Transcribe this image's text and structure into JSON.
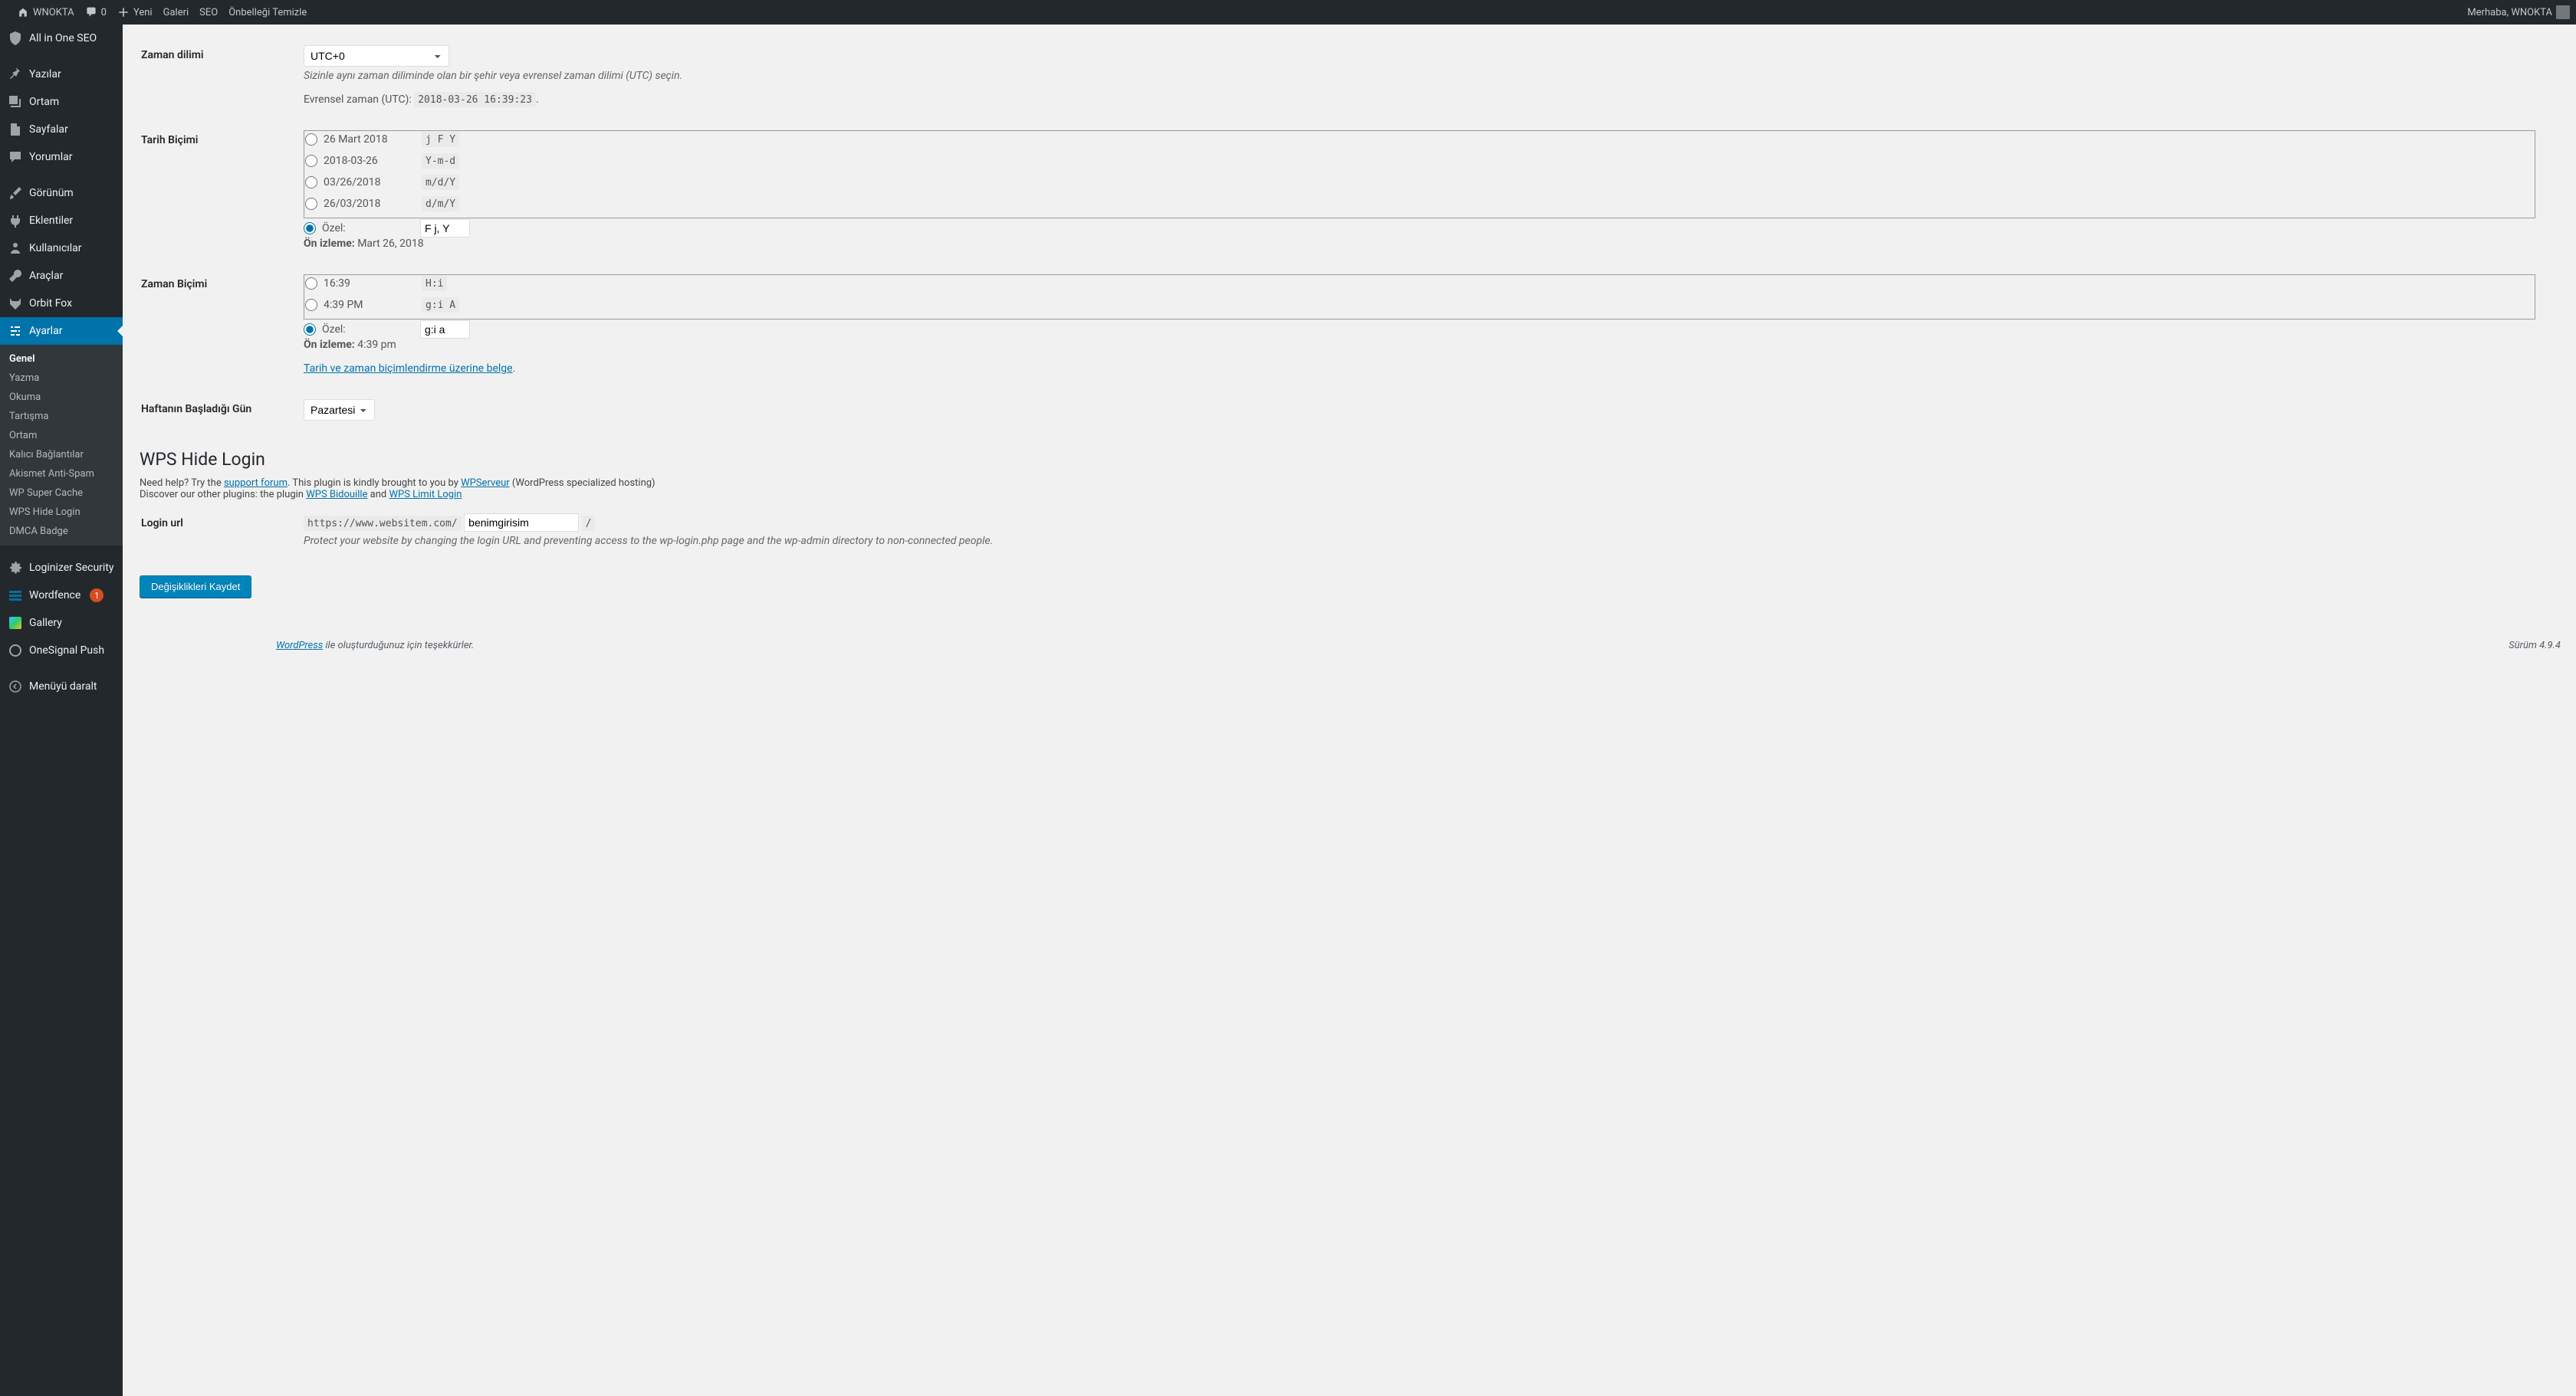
{
  "adminbar": {
    "site": "WNOKTA",
    "comments": "0",
    "new": "Yeni",
    "gallery": "Galeri",
    "seo": "SEO",
    "cache": "Önbelleği Temizle",
    "greeting": "Merhaba, WNOKTA"
  },
  "menu": {
    "aioseo": "All in One SEO",
    "posts": "Yazılar",
    "media": "Ortam",
    "pages": "Sayfalar",
    "comments": "Yorumlar",
    "appearance": "Görünüm",
    "plugins": "Eklentiler",
    "users": "Kullanıcılar",
    "tools": "Araçlar",
    "orbitfox": "Orbit Fox",
    "settings": "Ayarlar",
    "loginizer": "Loginizer Security",
    "wordfence": "Wordfence",
    "wordfence_badge": "1",
    "gallery": "Gallery",
    "onesignal": "OneSignal Push",
    "collapse": "Menüyü daralt"
  },
  "submenu": {
    "general": "Genel",
    "writing": "Yazma",
    "reading": "Okuma",
    "discussion": "Tartışma",
    "media": "Ortam",
    "permalinks": "Kalıcı Bağlantılar",
    "akismet": "Akismet Anti-Spam",
    "wpsc": "WP Super Cache",
    "wps": "WPS Hide Login",
    "dmca": "DMCA Badge"
  },
  "form": {
    "timezone_label": "Zaman dilimi",
    "timezone_value": "UTC+0",
    "timezone_desc": "Sizinle aynı zaman diliminde olan bir şehir veya evrensel zaman dilimi (UTC) seçin.",
    "utc_label": "Evrensel zaman (UTC): ",
    "utc_value": "2018-03-26 16:39:23",
    "utc_period": ".",
    "date_label": "Tarih Biçimi",
    "date_opts": [
      {
        "text": "26 Mart 2018",
        "code": "j F Y"
      },
      {
        "text": "2018-03-26",
        "code": "Y-m-d"
      },
      {
        "text": "03/26/2018",
        "code": "m/d/Y"
      },
      {
        "text": "26/03/2018",
        "code": "d/m/Y"
      }
    ],
    "custom": "Özel:",
    "date_custom_value": "F j, Y",
    "preview_label": "Ön izleme:",
    "date_preview": " Mart 26, 2018",
    "time_label": "Zaman Biçimi",
    "time_opts": [
      {
        "text": "16:39",
        "code": "H:i"
      },
      {
        "text": "4:39 PM",
        "code": "g:i A"
      }
    ],
    "time_custom_value": "g:i a",
    "time_preview": " 4:39 pm",
    "doc_link": "Tarih ve zaman biçimlendirme üzerine belge",
    "doc_period": ".",
    "weekstart_label": "Haftanın Başladığı Gün",
    "weekstart_value": "Pazartesi"
  },
  "wps": {
    "title": "WPS Hide Login",
    "help_pre": "Need help? Try the ",
    "help_link": "support forum",
    "help_mid": ". This plugin is kindly brought to you by ",
    "help_wps": "WPServeur",
    "help_post": " (WordPress specialized hosting)",
    "discover_pre": "Discover our other plugins: the plugin ",
    "discover_bid": "WPS Bidouille",
    "discover_and": " and ",
    "discover_limit": "WPS Limit Login",
    "login_label": "Login url",
    "login_prefix": "https://www.websitem.com/",
    "login_value": "benimgirisim",
    "login_suffix": "/",
    "login_desc": "Protect your website by changing the login URL and preventing access to the wp-login.php page and the wp-admin directory to non-connected people."
  },
  "submit": "Değişiklikleri Kaydet",
  "footer": {
    "wp": "WordPress",
    "thanks": " ile oluşturduğunuz için teşekkürler.",
    "version": "Sürüm 4.9.4"
  }
}
